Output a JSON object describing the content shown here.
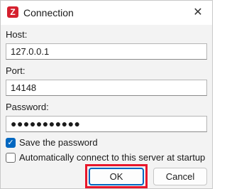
{
  "window": {
    "app_icon": "filezilla-server-icon",
    "app_icon_glyph": "Z",
    "title": "Connection",
    "close_glyph": "✕"
  },
  "form": {
    "host_label": "Host:",
    "host_value": "127.0.0.1",
    "port_label": "Port:",
    "port_value": "14148",
    "password_label": "Password:",
    "password_value": "●●●●●●●●●●●"
  },
  "options": {
    "save_password_label": "Save the password",
    "save_password_checked": true,
    "auto_connect_label": "Automatically connect to this server at startup",
    "auto_connect_checked": false,
    "check_glyph": "✓"
  },
  "buttons": {
    "ok_label": "OK",
    "cancel_label": "Cancel"
  },
  "colors": {
    "accent": "#0067c0",
    "highlight_box": "#e8162b",
    "app_icon_bg": "#d5202e"
  }
}
